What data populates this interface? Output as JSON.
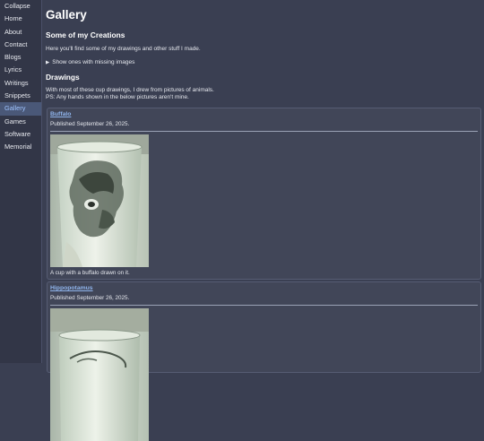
{
  "nav": {
    "items": [
      "Collapse",
      "Home",
      "About",
      "Contact",
      "Blogs",
      "Lyrics",
      "Writings",
      "Snippets",
      "Gallery",
      "Games",
      "Software",
      "Memorial"
    ],
    "active": "Gallery"
  },
  "page": {
    "title": "Gallery",
    "section_title": "Some of my Creations",
    "intro": "Here you'll find some of my drawings and other stuff I made.",
    "details_label": "Show ones with missing images",
    "drawings_title": "Drawings",
    "drawings_note_1": "With most of these cup drawings, I drew from pictures of animals.",
    "drawings_note_2": "PS: Any hands shown in the below pictures aren't mine."
  },
  "items": [
    {
      "title": "Buffalo",
      "date": "Published September 26, 2025.",
      "caption": "A cup with a buffalo drawn on it."
    },
    {
      "title": "Hippopotamus",
      "date": "Published September 26, 2025.",
      "caption": ""
    }
  ],
  "colors": {
    "background": "#3a3f52",
    "sidebar": "#323647",
    "active_nav": "#4a5878",
    "link": "#8fb4ec",
    "card": "#414658"
  }
}
